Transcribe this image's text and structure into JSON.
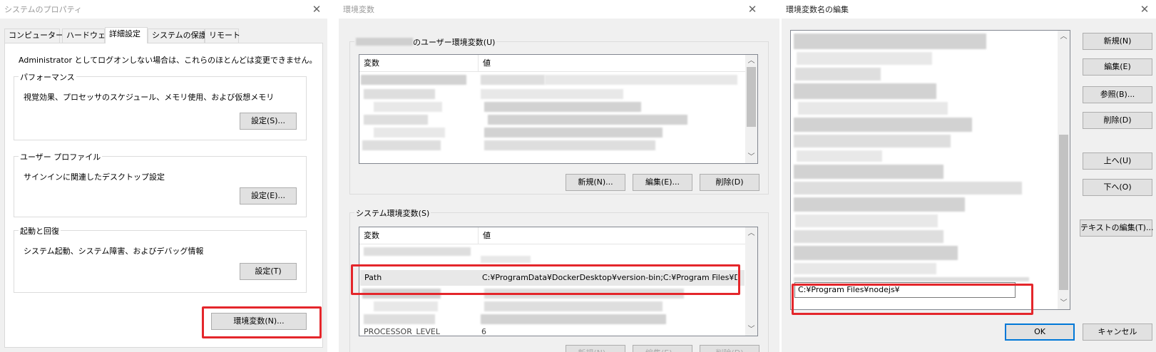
{
  "dialog1": {
    "title": "システムのプロパティ",
    "tabs": [
      "コンピューター名",
      "ハードウェア",
      "詳細設定",
      "システムの保護",
      "リモート"
    ],
    "note": "Administrator としてログオンしない場合は、これらのほとんどは変更できません。",
    "performance": {
      "label": "パフォーマンス",
      "desc": "視覚効果、プロセッサのスケジュール、メモリ使用、および仮想メモリ",
      "button": "設定(S)..."
    },
    "profile": {
      "label": "ユーザー プロファイル",
      "desc": "サインインに関連したデスクトップ設定",
      "button": "設定(E)..."
    },
    "startup": {
      "label": "起動と回復",
      "desc": "システム起動、システム障害、およびデバッグ情報",
      "button": "設定(T)"
    },
    "env_button": "環境変数(N)..."
  },
  "dialog2": {
    "title": "環境変数",
    "user_vars_label_suffix": "のユーザー環境変数(U)",
    "columns": {
      "variable": "変数",
      "value": "値"
    },
    "user_buttons": {
      "new": "新規(N)...",
      "edit": "編集(E)...",
      "delete": "削除(D)"
    },
    "system_vars_label": "システム環境変数(S)",
    "path_row": {
      "name": "Path",
      "value": "C:¥ProgramData¥DockerDesktop¥version-bin;C:¥Program Files¥Doc..."
    },
    "partial_row_name": "PROCESSOR_LEVEL",
    "partial_row_value": "6"
  },
  "dialog3": {
    "title": "環境変数名の編集",
    "edit_value": "C:¥Program Files¥nodejs¥",
    "buttons": {
      "new": "新規(N)",
      "edit": "編集(E)",
      "browse": "参照(B)...",
      "delete": "削除(D)",
      "up": "上へ(U)",
      "down": "下へ(O)",
      "text_edit": "テキストの編集(T)...",
      "ok": "OK",
      "cancel": "キャンセル"
    }
  },
  "icons": {
    "close": "close-icon",
    "scroll_up": "scroll-up-icon",
    "scroll_down": "scroll-down-icon"
  },
  "colors": {
    "highlight": "#e4262b",
    "accent": "#0078d7",
    "dialog_bg": "#f0f0f0"
  }
}
